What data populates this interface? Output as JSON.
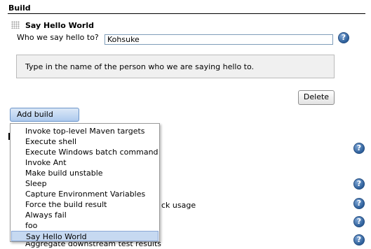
{
  "section": {
    "title": "Build"
  },
  "build_step": {
    "title": "Say Hello World",
    "field_label": "Who we say hello to?",
    "field_value": "Kohsuke",
    "help_text": "Type in the name of the person who we are saying hello to.",
    "delete_label": "Delete",
    "help_glyph": "?"
  },
  "add_build_step": {
    "label": "Add build step",
    "arrow": "▼"
  },
  "menu": {
    "items": [
      "Invoke top-level Maven targets",
      "Execute shell",
      "Execute Windows batch command",
      "Invoke Ant",
      "Make build unstable",
      "Sleep",
      "Capture Environment Variables",
      "Force the build result",
      "Always fail",
      "foo",
      "Say Hello World"
    ],
    "selected": "Say Hello World"
  },
  "background": {
    "partial_text": "ck usage",
    "bottom_partial_text": "Aggregate downstream test results"
  },
  "colors": {
    "accent": "#2d5f9a",
    "selection": "#c6d9f1"
  },
  "icons": {
    "help": "help-icon",
    "drag": "drag-handle-icon",
    "dropdown": "chevron-down-icon"
  }
}
